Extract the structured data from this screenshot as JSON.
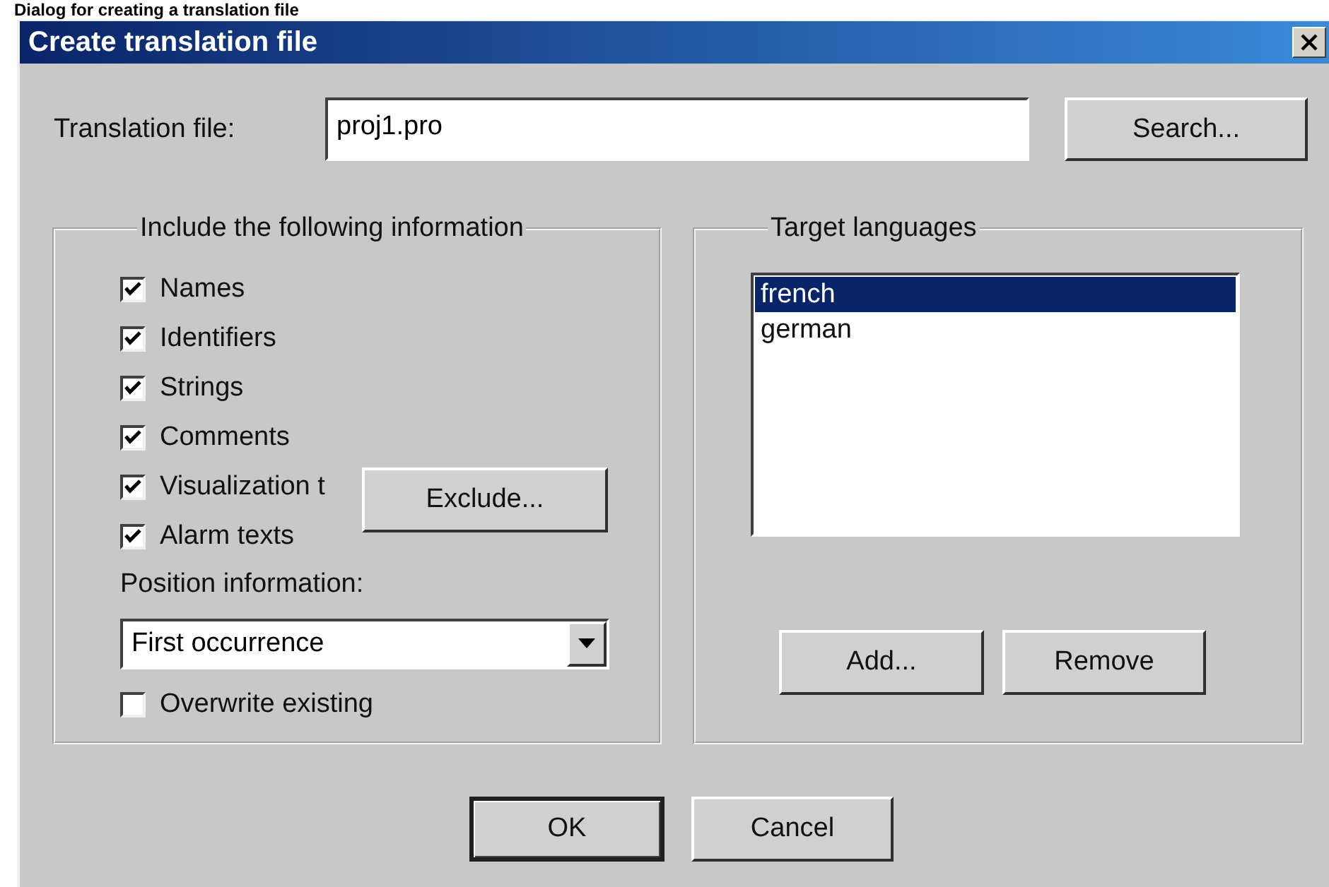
{
  "caption": "Dialog for creating a translation file",
  "window": {
    "title": "Create translation file"
  },
  "translation_file": {
    "label": "Translation file:",
    "value": "proj1.pro",
    "button": "Search..."
  },
  "include_group": {
    "title": "Include the following information",
    "options": [
      {
        "label": "Names",
        "checked": true
      },
      {
        "label": "Identifiers",
        "checked": true
      },
      {
        "label": "Strings",
        "checked": true
      },
      {
        "label": "Comments",
        "checked": true
      },
      {
        "label": "Visualization t",
        "checked": true
      },
      {
        "label": "Alarm texts",
        "checked": true
      }
    ],
    "exclude_button": "Exclude...",
    "position_label": "Position information:",
    "position_value": "First occurrence",
    "overwrite": {
      "label": "Overwrite existing",
      "checked": false
    }
  },
  "languages_group": {
    "title": "Target languages",
    "items": [
      {
        "label": "french",
        "selected": true
      },
      {
        "label": "german",
        "selected": false
      }
    ],
    "buttons": [
      "Add...",
      "Remove"
    ]
  },
  "buttons": [
    "OK",
    "Cancel"
  ]
}
